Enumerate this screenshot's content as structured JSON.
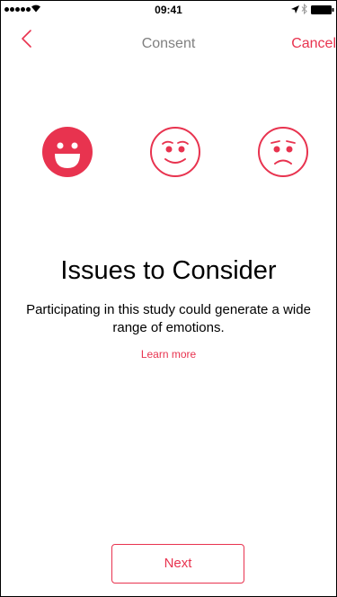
{
  "status_bar": {
    "time": "09:41"
  },
  "nav": {
    "title": "Consent",
    "cancel_label": "Cancel",
    "back_icon": "chevron-left-icon"
  },
  "emojis": [
    {
      "name": "happy-face-icon",
      "mood": "happy"
    },
    {
      "name": "content-face-icon",
      "mood": "content"
    },
    {
      "name": "worried-face-icon",
      "mood": "worried"
    }
  ],
  "content": {
    "heading": "Issues to Consider",
    "body": "Participating in this study could generate a wide range of emotions.",
    "learn_more": "Learn more"
  },
  "footer": {
    "next_label": "Next"
  },
  "colors": {
    "accent": "#e8334f",
    "nav_title": "#7f7f7f",
    "text": "#000000"
  }
}
